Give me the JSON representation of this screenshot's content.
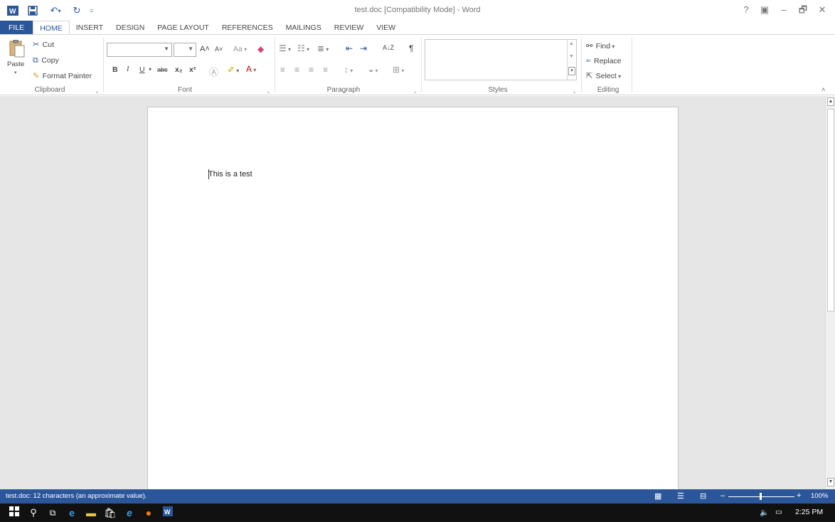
{
  "window": {
    "title": "test.doc [Compatibility Mode] - Word",
    "quick_access": {
      "word_icon": "word-icon",
      "save_icon": "save-icon",
      "undo_icon": "undo-icon",
      "redo_icon": "redo-icon",
      "customize_icon": "customize-qat-icon"
    },
    "controls": {
      "help": "?",
      "ribbon_display": "▣",
      "minimize": "–",
      "restore": "🗗",
      "close": "✕"
    }
  },
  "tabs": [
    "FILE",
    "HOME",
    "INSERT",
    "DESIGN",
    "PAGE LAYOUT",
    "REFERENCES",
    "MAILINGS",
    "REVIEW",
    "VIEW"
  ],
  "active_tab": "HOME",
  "ribbon": {
    "clipboard": {
      "label": "Clipboard",
      "paste": "Paste",
      "cut": "Cut",
      "copy": "Copy",
      "format_painter": "Format Painter"
    },
    "font": {
      "label": "Font",
      "font_name": "",
      "font_size": "",
      "bold": "B",
      "italic": "I",
      "underline": "U",
      "strikethrough": "abc",
      "subscript": "x₂",
      "superscript": "x²",
      "grow": "A˄",
      "shrink": "A˅",
      "change_case": "Aa",
      "font_color": "A"
    },
    "paragraph": {
      "label": "Paragraph",
      "sort": "A↓Z",
      "pilcrow": "¶"
    },
    "styles": {
      "label": "Styles"
    },
    "editing": {
      "label": "Editing",
      "find": "Find",
      "replace": "Replace",
      "select": "Select"
    }
  },
  "document": {
    "text": "This is a test"
  },
  "status": {
    "text": "test.doc: 12 characters (an approximate value).",
    "zoom": "100%"
  },
  "taskbar": {
    "time": "2:25 PM"
  },
  "colors": {
    "accent": "#2b579a",
    "doc_background": "#e6e6e6",
    "taskbar": "#111111"
  }
}
